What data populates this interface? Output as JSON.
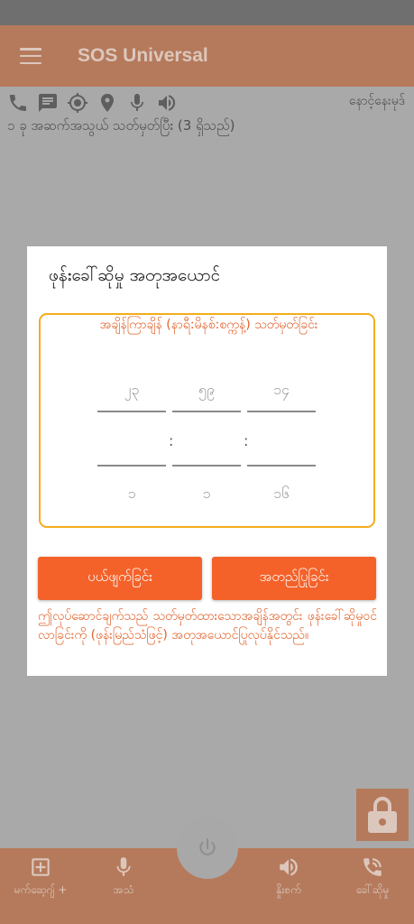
{
  "app": {
    "title": "SOS Universal"
  },
  "status": {
    "location_text": "နောင့်နေးမုဒ်",
    "confirm_text": "၁ ခု အဆက်အသွယ် သတ်မှတ်ပြီး (3 ရှိသည်)"
  },
  "status_icons": [
    "phone-icon",
    "message-icon",
    "gps-target-icon",
    "location-pin-icon",
    "microphone-icon",
    "speaker-icon"
  ],
  "dialog": {
    "title": "ဖုန်းခေါ်ဆိုမှု အတုအယောင်",
    "time_label": "အချိန်ကြာချိန် (နာရီ:မိနစ်:စက္ကန့်) သတ်မှတ်ခြင်း",
    "picker": {
      "hours": {
        "above": "၂၃",
        "below": "၁"
      },
      "minutes": {
        "above": "၅၉",
        "below": "၁"
      },
      "seconds": {
        "above": "၁၄",
        "below": "၁၆"
      },
      "separator": ":"
    },
    "cancel_label": "ပယ်ဖျက်ခြင်း",
    "set_label": "အတည်ပြုခြင်း",
    "note": "ဤလုပ်ဆောင်ချက်သည် သတ်မှတ်ထားသောအချိန်အတွင်း ဖုန်းခေါ်ဆိုမှုဝင်လာခြင်းကို (ဖုန်းမြည်သံဖြင့်) အတုအယောင်ပြုလုပ်နိုင်သည်။"
  },
  "bottom_nav": {
    "add_message": "မက်ဆေ့ဂျ် +",
    "voice": "အသံ",
    "ring": "နှိုးစက်",
    "fake_call": "ခေါ်ဆိုမှု"
  },
  "colors": {
    "accent": "#f4622a",
    "box_border": "#f3ad1b",
    "appbar": "#b57a5c",
    "overlay": "#a9a9a9"
  }
}
